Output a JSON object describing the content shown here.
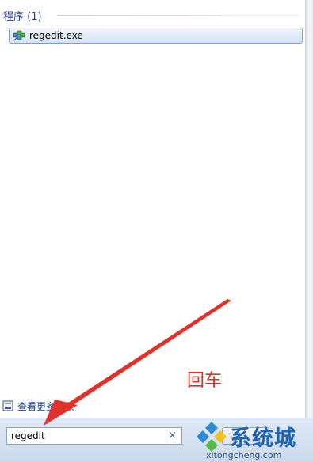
{
  "results": {
    "section_title": "程序 (1)",
    "items": [
      {
        "label": "regedit.exe",
        "icon": "regedit-icon"
      }
    ]
  },
  "footer": {
    "see_more_label": "查看更多结果",
    "see_more_icon": "search-results-icon"
  },
  "search": {
    "value": "regedit",
    "clear_icon": "×"
  },
  "annotation": {
    "text": "回车",
    "color": "#d9302a"
  },
  "watermark": {
    "title": "系统城",
    "url": "xitongcheng.com",
    "brand_color": "#1c62b5"
  },
  "colors": {
    "accent": "#1e3f8f",
    "selection": "#d3e3f7"
  }
}
